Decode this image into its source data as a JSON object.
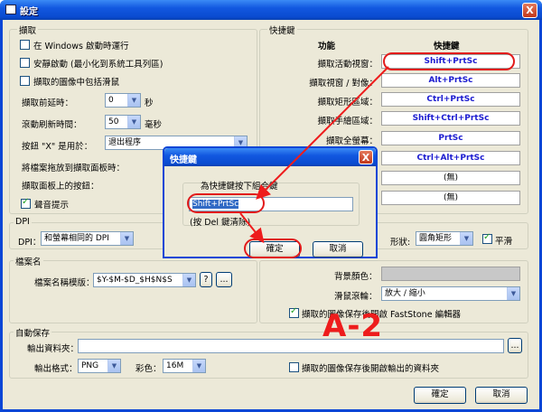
{
  "window": {
    "title": "設定",
    "close_label": "X"
  },
  "capture": {
    "legend": "擷取",
    "run_on_startup": {
      "label": "在 Windows 啟動時運行",
      "checked": false
    },
    "quiet_start": {
      "label": "安靜啟動 (最小化到系統工具列區)",
      "checked": false
    },
    "include_cursor": {
      "label": "擷取的圖像中包括滑鼠",
      "checked": false
    },
    "delay_label": "擷取前延時：",
    "delay_value": "0",
    "delay_unit": "秒",
    "scroll_label": "滾動刷新時間：",
    "scroll_value": "50",
    "scroll_unit": "毫秒",
    "x_button_label": "按鈕 \"X\" 是用於：",
    "x_button_value": "退出程序",
    "drag_label": "將檔案拖放到擷取面板時：",
    "panel_buttons_label": "擷取面板上的按鈕：",
    "sound": {
      "label": "聲音提示",
      "checked": true
    }
  },
  "hotkeys": {
    "legend": "快捷鍵",
    "col_function": "功能",
    "col_hotkey": "快捷鍵",
    "rows": [
      {
        "label": "擷取活動視窗：",
        "value": "Shift+PrtSc"
      },
      {
        "label": "擷取視窗 / 對像：",
        "value": "Alt+PrtSc"
      },
      {
        "label": "擷取矩形區域：",
        "value": "Ctrl+PrtSc"
      },
      {
        "label": "擷取手繪區域：",
        "value": "Shift+Ctrl+PrtSc"
      },
      {
        "label": "擷取全螢幕：",
        "value": "PrtSc"
      },
      {
        "label": "",
        "value": "Ctrl+Alt+PrtSc"
      },
      {
        "label": "",
        "value": "(無)"
      },
      {
        "label": "",
        "value": "(無)"
      }
    ]
  },
  "dpi": {
    "legend": "DPI",
    "label": "DPI：",
    "value": "和螢幕相同的 DPI",
    "shape_label": "形狀:",
    "shape_value": "圓角矩形",
    "smooth": {
      "label": "平滑",
      "checked": true
    }
  },
  "filename": {
    "legend": "檔案名",
    "template_label": "檔案名稱模版：",
    "template_value": "$Y-$M-$D_$H$N$S",
    "help_label": "?",
    "more_label": "..."
  },
  "editor": {
    "bg_color_label": "背景顏色：",
    "wheel_label": "滑鼠滾輪：",
    "wheel_value": "放大 / 縮小",
    "open_editor": {
      "label": "擷取的圖像保存後開啟 FastStone 編輯器",
      "checked": true
    }
  },
  "autosave": {
    "legend": "自動保存",
    "output_folder_label": "輸出資料夾：",
    "output_folder_value": "",
    "browse_label": "...",
    "format_label": "輸出格式：",
    "format_value": "PNG",
    "color_label": "彩色：",
    "color_value": "16M",
    "open_folder": {
      "label": "擷取的圖像保存後開啟輸出的資料夾",
      "checked": false
    }
  },
  "footer": {
    "ok_label": "確定",
    "cancel_label": "取消"
  },
  "modal": {
    "title": "快捷鍵",
    "close_label": "X",
    "prompt": "為快捷鍵按下組合鍵",
    "value": "Shift+PrtSc",
    "hint": "(按 Del 鍵清除)",
    "ok_label": "確定",
    "cancel_label": "取消"
  },
  "annotation": {
    "label": "A-2",
    "color": "#ee1c1c"
  }
}
